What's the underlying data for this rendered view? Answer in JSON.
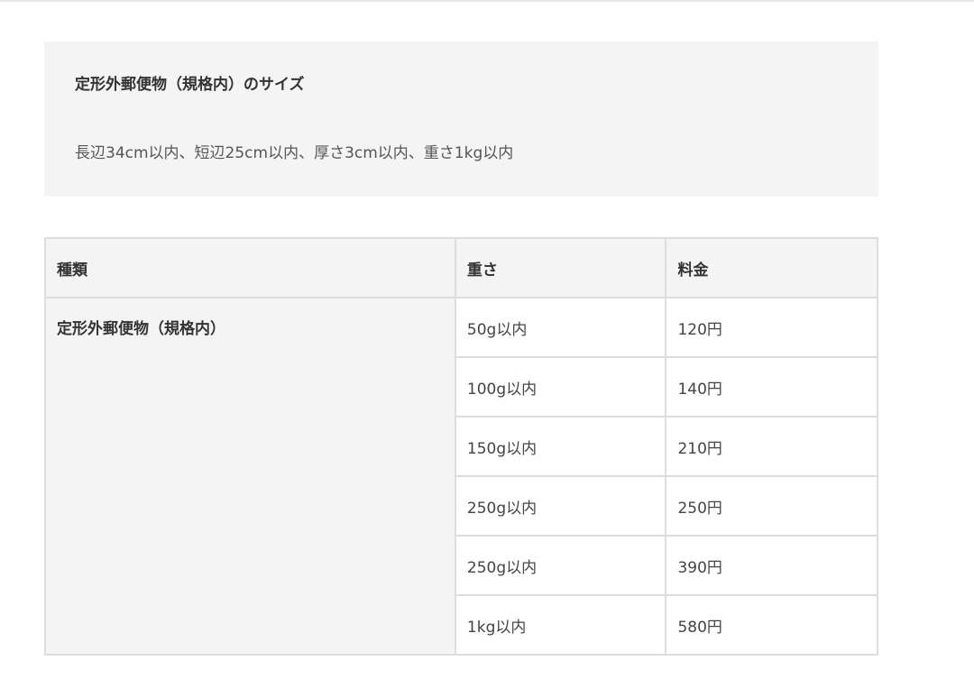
{
  "info": {
    "title": "定形外郵便物（規格内）のサイズ",
    "text": "長辺34cm以内、短辺25cm以内、厚さ3cm以内、重さ1kg以内"
  },
  "table": {
    "headers": [
      "種類",
      "重さ",
      "料金"
    ],
    "type_label": "定形外郵便物（規格内）",
    "rows": [
      {
        "weight": "50g以内",
        "price": "120円"
      },
      {
        "weight": "100g以内",
        "price": "140円"
      },
      {
        "weight": "150g以内",
        "price": "210円"
      },
      {
        "weight": "250g以内",
        "price": "250円"
      },
      {
        "weight": "250g以内",
        "price": "390円"
      },
      {
        "weight": "1kg以内",
        "price": "580円"
      }
    ]
  }
}
